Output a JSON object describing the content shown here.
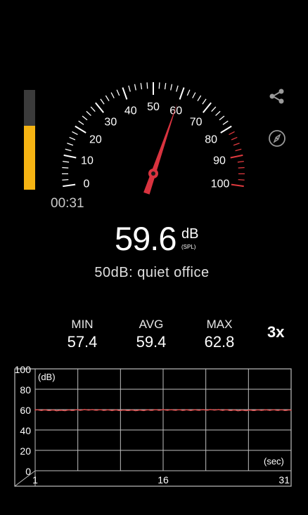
{
  "colors": {
    "background": "#000000",
    "level_bar_track": "#3b3b3b",
    "level_bar_fill": "#f6b413",
    "gauge_tick": "#ffffff",
    "gauge_tick_danger": "#e0393e",
    "needle": "#d9333f",
    "trace": "#d95050",
    "grid": "#bfbfbf",
    "icon": "#9a9a9a"
  },
  "level_meter": {
    "level_fraction": 0.64
  },
  "timer": "00:31",
  "gauge": {
    "min": 0,
    "max": 100,
    "danger_from": 80,
    "needle_value": 59.6,
    "labels": [
      "0",
      "10",
      "20",
      "30",
      "40",
      "50",
      "60",
      "70",
      "80",
      "90",
      "100"
    ]
  },
  "icons": {
    "share": "share-icon",
    "compass": "compass-icon"
  },
  "reading": {
    "value": "59.6",
    "unit": "dB",
    "sub_unit": "(SPL)"
  },
  "description": "50dB: quiet office",
  "stats": {
    "min_label": "MIN",
    "min_value": "57.4",
    "avg_label": "AVG",
    "avg_value": "59.4",
    "max_label": "MAX",
    "max_value": "62.8"
  },
  "multiplier": "3x",
  "chart_data": {
    "type": "line",
    "ylabel": "(dB)",
    "xlabel": "(sec)",
    "ylim": [
      0,
      100
    ],
    "xlim": [
      1,
      31
    ],
    "y_ticks": [
      "100",
      "80",
      "60",
      "40",
      "20",
      "0"
    ],
    "x_ticks": [
      "1",
      "16",
      "31"
    ],
    "grid": true,
    "x": [
      1,
      4,
      7,
      10,
      13,
      16,
      19,
      22,
      25,
      28,
      31
    ],
    "values": [
      59.6,
      59.2,
      59.8,
      59.4,
      59.3,
      59.7,
      59.5,
      59.8,
      59.2,
      59.6,
      59.4
    ]
  }
}
